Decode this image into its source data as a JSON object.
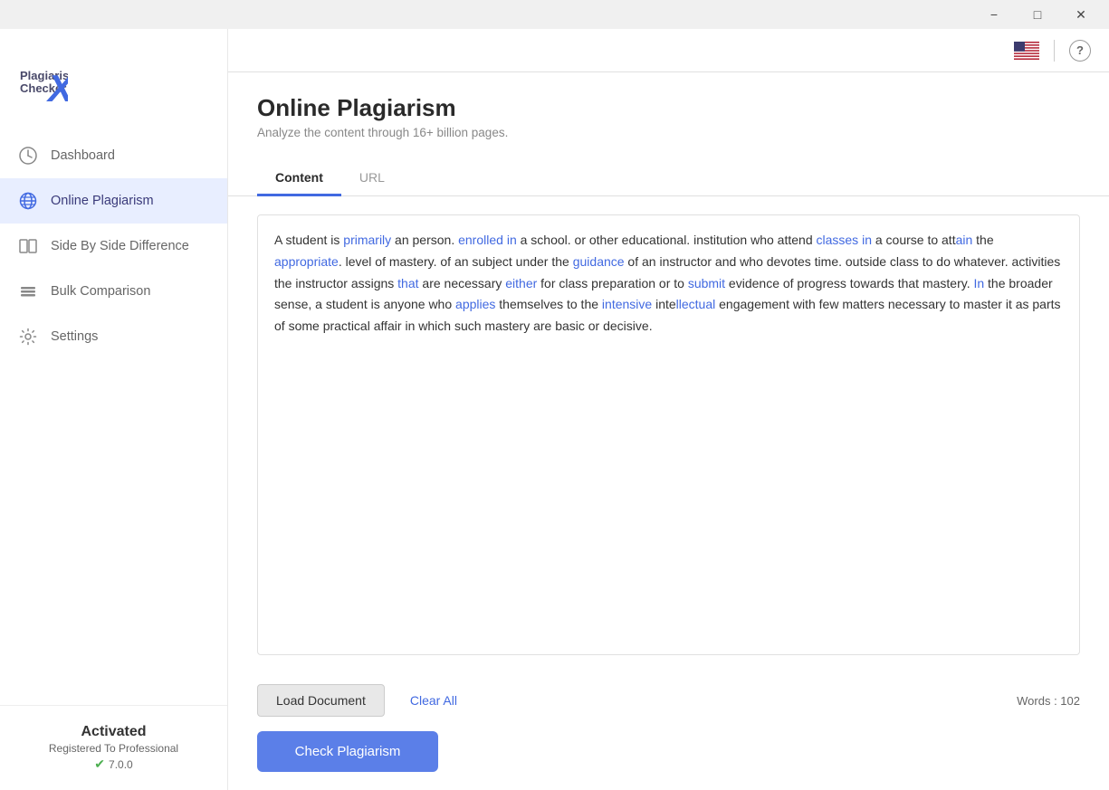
{
  "titleBar": {
    "minimizeTitle": "Minimize",
    "maximizeTitle": "Maximize",
    "closeTitle": "Close"
  },
  "sidebar": {
    "logoTextLine1": "Plagiarism",
    "logoTextLine2": "Checker",
    "navItems": [
      {
        "id": "dashboard",
        "label": "Dashboard",
        "icon": "dashboard-icon",
        "active": false
      },
      {
        "id": "online-plagiarism",
        "label": "Online Plagiarism",
        "icon": "globe-icon",
        "active": true
      },
      {
        "id": "side-by-side",
        "label": "Side By Side Difference",
        "icon": "sbs-icon",
        "active": false
      },
      {
        "id": "bulk-comparison",
        "label": "Bulk Comparison",
        "icon": "bulk-icon",
        "active": false
      },
      {
        "id": "settings",
        "label": "Settings",
        "icon": "settings-icon",
        "active": false
      }
    ],
    "bottom": {
      "activatedLabel": "Activated",
      "registeredLabel": "Registered To Professional",
      "version": "7.0.0"
    }
  },
  "topBar": {
    "helpLabel": "?"
  },
  "mainContent": {
    "pageTitle": "Online Plagiarism",
    "pageSubtitle": "Analyze the content through 16+ billion pages.",
    "tabs": [
      {
        "id": "content",
        "label": "Content",
        "active": true
      },
      {
        "id": "url",
        "label": "URL",
        "active": false
      }
    ],
    "editorContent": "A student is primarily an person. enrolled in a school. or other educational. institution who attend classes in a course to attain the appropriate. level of mastery. of an subject under the guidance of an instructor and who devotes time. outside class to do whatever. activities the instructor assigns that are necessary either for class preparation or to submit evidence of progress towards that mastery. In the broader sense, a student is anyone who applies themselves to the intensive intellectual engagement with few matters necessary to master it as parts of some practical affair in which such mastery are basic or decisive.",
    "wordCount": "Words : 102",
    "buttons": {
      "loadDocument": "Load Document",
      "clearAll": "Clear All",
      "checkPlagiarism": "Check Plagiarism"
    }
  }
}
